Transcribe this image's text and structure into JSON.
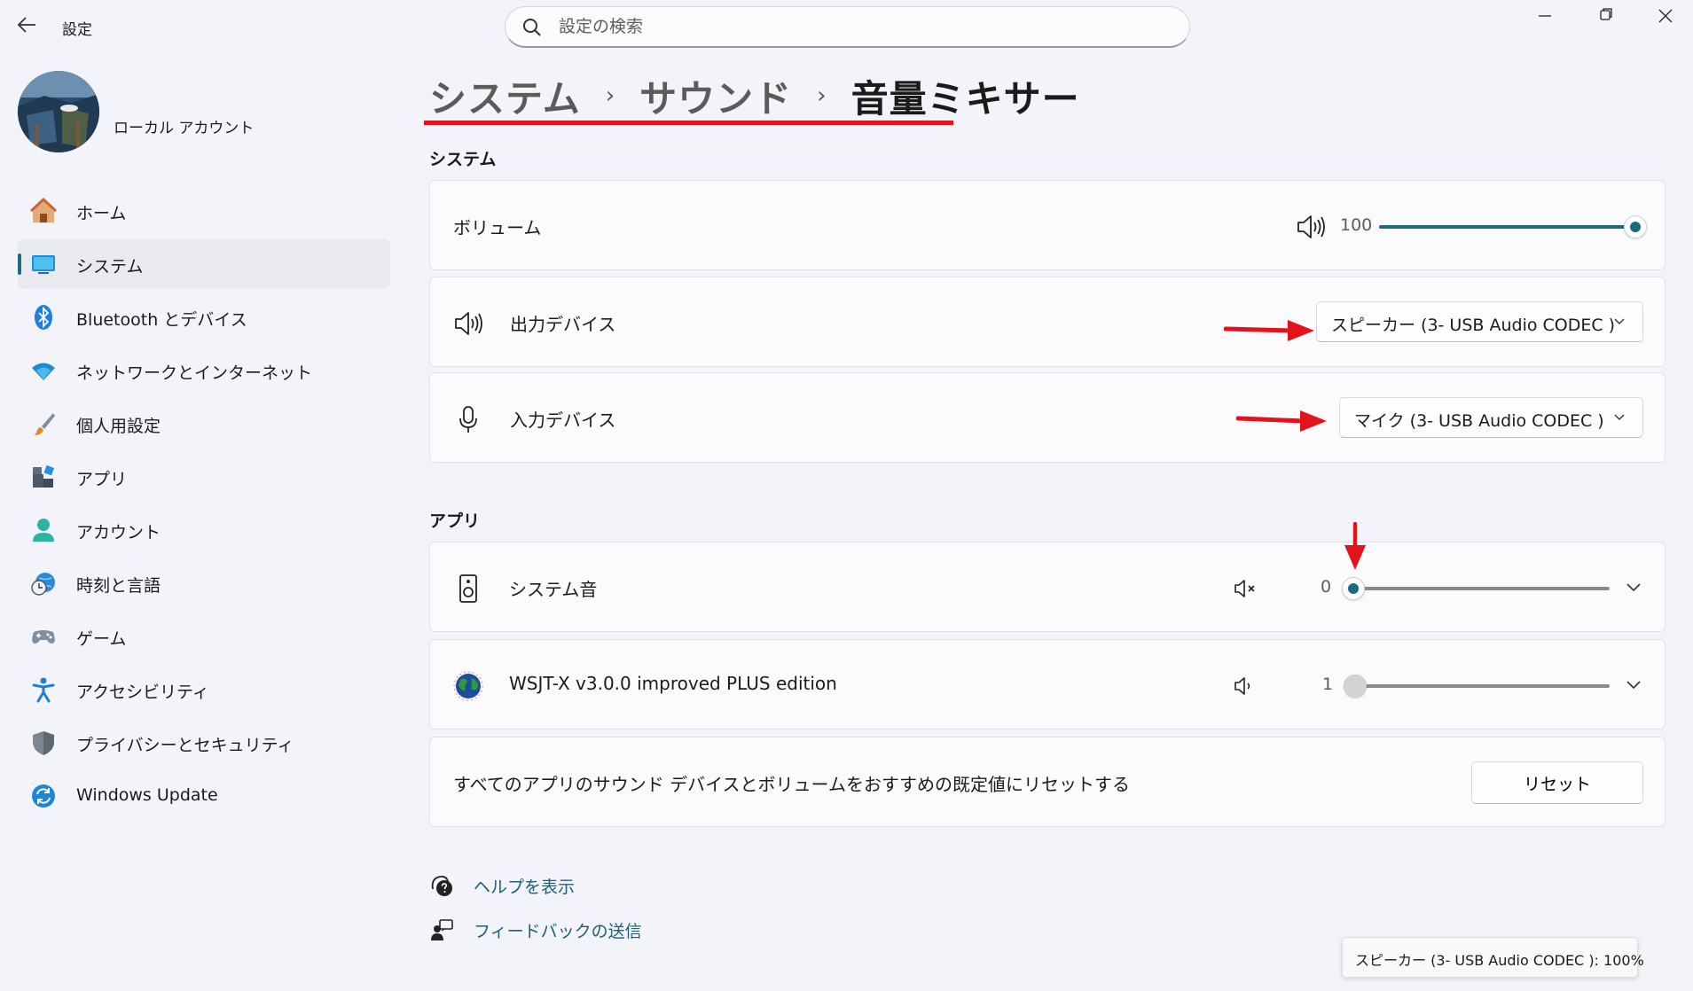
{
  "window": {
    "title": "設定",
    "controls": [
      "minimize-icon",
      "maximize-icon",
      "close-icon"
    ]
  },
  "search": {
    "placeholder": "設定の検索"
  },
  "profile": {
    "name": "ローカル アカウント"
  },
  "nav": {
    "active": "システム",
    "items": [
      {
        "label": "ホーム",
        "icon": "home-icon"
      },
      {
        "label": "システム",
        "icon": "system-icon"
      },
      {
        "label": "Bluetooth とデバイス",
        "icon": "bluetooth-icon"
      },
      {
        "label": "ネットワークとインターネット",
        "icon": "wifi-icon"
      },
      {
        "label": "個人用設定",
        "icon": "brush-icon"
      },
      {
        "label": "アプリ",
        "icon": "apps-icon"
      },
      {
        "label": "アカウント",
        "icon": "account-icon"
      },
      {
        "label": "時刻と言語",
        "icon": "clock-globe-icon"
      },
      {
        "label": "ゲーム",
        "icon": "gamepad-icon"
      },
      {
        "label": "アクセシビリティ",
        "icon": "accessibility-icon"
      },
      {
        "label": "プライバシーとセキュリティ",
        "icon": "shield-icon"
      },
      {
        "label": "Windows Update",
        "icon": "update-icon"
      }
    ]
  },
  "breadcrumb": [
    "システム",
    "サウンド",
    "音量ミキサー"
  ],
  "system_section": {
    "heading": "システム",
    "volume": {
      "label": "ボリューム",
      "value": "100",
      "level": 1.0
    },
    "output": {
      "label": "出力デバイス",
      "selected": "スピーカー (3- USB Audio CODEC )"
    },
    "input": {
      "label": "入力デバイス",
      "selected": "マイク (3- USB Audio CODEC )"
    }
  },
  "apps_section": {
    "heading": "アプリ",
    "apps": [
      {
        "name": "システム音",
        "value": "0",
        "level": 0.0,
        "muted": true,
        "enabled": true
      },
      {
        "name": "WSJT-X   v3.0.0  improved PLUS edition",
        "value": "1",
        "level": 0.01,
        "muted": false,
        "enabled": false
      }
    ],
    "reset": {
      "text": "すべてのアプリのサウンド デバイスとボリュームをおすすめの既定値にリセットする",
      "button": "リセット"
    }
  },
  "links": {
    "help": "ヘルプを表示",
    "feedback": "フィードバックの送信"
  },
  "tooltip": "スピーカー (3- USB Audio CODEC ): 100%",
  "colors": {
    "accent": "#1a6b7e",
    "annotation": "#e3121b",
    "background": "#f3f4f9"
  }
}
